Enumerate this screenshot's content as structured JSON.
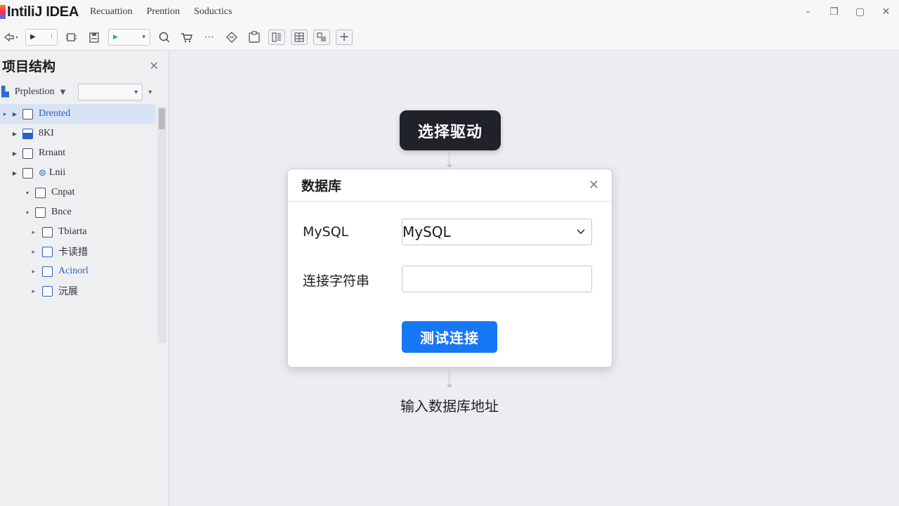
{
  "app": {
    "logo_text": "IntiliJ IDEA",
    "menu": [
      "Recuattion",
      "Prention",
      "Soductics"
    ]
  },
  "window_controls": {
    "minimize": "–",
    "restore": "❐",
    "maximize": "▢",
    "close": "✕"
  },
  "toolbar": {
    "icons": [
      "back-icon",
      "run-config-icon",
      "build-icon",
      "save-icon",
      "run-icon",
      "search-icon",
      "cart-icon",
      "more-icon",
      "git-icon",
      "clipboard-icon",
      "layout-icon",
      "grid-icon",
      "split-icon",
      "add-icon"
    ],
    "more_label": "⋯",
    "add_label": "+",
    "run_config_label": "▶"
  },
  "sidebar": {
    "title": "项目结构",
    "filter_label": "Prplestion",
    "items": [
      {
        "label": "Drented",
        "selected": true,
        "blue": true
      },
      {
        "label": "8KI"
      },
      {
        "label": "Rrnant"
      },
      {
        "label": "Lnii"
      },
      {
        "label": "Cnpat"
      },
      {
        "label": "Bnce"
      },
      {
        "label": "Tbiarta"
      },
      {
        "label": "卡读措"
      },
      {
        "label": "Acinorl",
        "blue": true
      },
      {
        "label": "沅展"
      }
    ]
  },
  "annotations": {
    "top_pill": "选择驱动",
    "bottom_caption": "输入数据库地址"
  },
  "dialog": {
    "title": "数据库",
    "driver_label": "MySQL",
    "driver_value": "MySQL",
    "connection_label": "连接字符串",
    "connection_value": "",
    "test_button": "测试连接"
  },
  "colors": {
    "accent": "#1677f7",
    "pill_bg": "#1f2228",
    "selection": "#d8e4f6"
  }
}
